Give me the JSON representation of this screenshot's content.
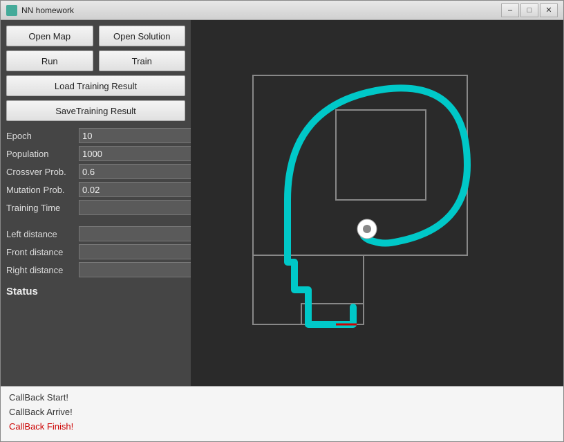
{
  "window": {
    "title": "NN homework"
  },
  "titlebar": {
    "minimize_label": "–",
    "restore_label": "□",
    "close_label": "✕"
  },
  "left_panel": {
    "open_map_label": "Open Map",
    "open_solution_label": "Open Solution",
    "run_label": "Run",
    "train_label": "Train",
    "load_training_label": "Load Training Result",
    "save_training_label": "SaveTraining Result",
    "fields": {
      "epoch_label": "Epoch",
      "epoch_value": "10",
      "population_label": "Population",
      "population_value": "1000",
      "crossver_label": "Crossver Prob.",
      "crossver_value": "0.6",
      "mutation_label": "Mutation Prob.",
      "mutation_value": "0.02",
      "training_time_label": "Training Time",
      "training_time_value": "",
      "left_distance_label": "Left distance",
      "left_distance_value": "",
      "front_distance_label": "Front distance",
      "front_distance_value": "",
      "right_distance_label": "Right distance",
      "right_distance_value": ""
    },
    "status_label": "Status"
  },
  "log": {
    "lines": [
      {
        "text": "CallBack Start!",
        "color": "normal"
      },
      {
        "text": "CallBack Arrive!",
        "color": "normal"
      },
      {
        "text": "CallBack Finish!",
        "color": "red"
      }
    ]
  }
}
